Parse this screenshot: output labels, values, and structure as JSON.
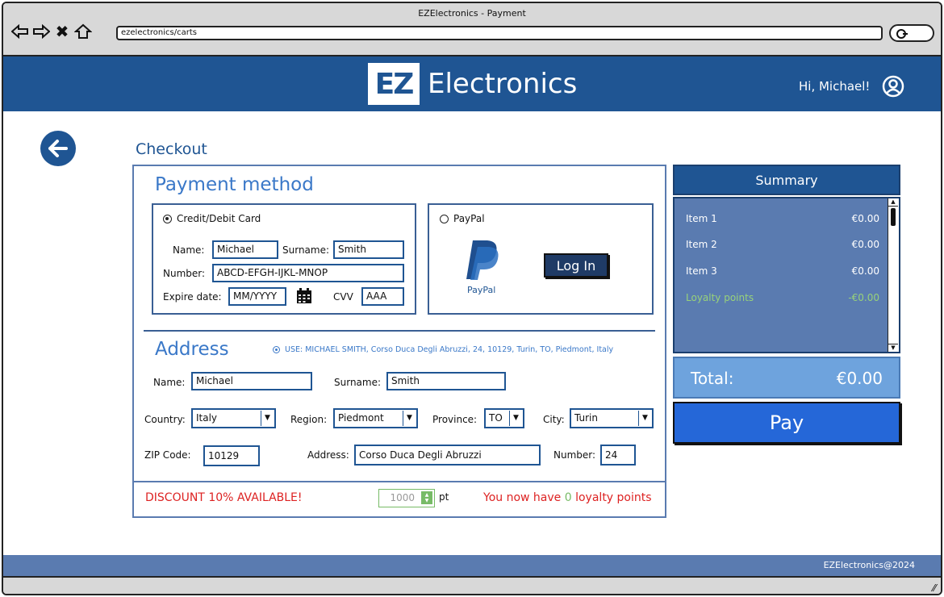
{
  "window": {
    "title": "EZElectronics - Payment",
    "url": "ezelectronics/carts"
  },
  "header": {
    "logo_mark": "EZ",
    "logo_text": "Electronics",
    "greeting": "Hi, Michael!"
  },
  "page": {
    "title": "Checkout"
  },
  "payment": {
    "section_title": "Payment method",
    "card_option": "Credit/Debit Card",
    "name_label": "Name:",
    "name_value": "Michael",
    "surname_label": "Surname:",
    "surname_value": "Smith",
    "number_label": "Number:",
    "number_value": "ABCD-EFGH-IJKL-MNOP",
    "expire_label": "Expire date:",
    "expire_value": "MM/YYYY",
    "cvv_label": "CVV",
    "cvv_value": "AAA",
    "paypal_option": "PayPal",
    "paypal_caption": "PayPal",
    "login_label": "Log In"
  },
  "address": {
    "section_title": "Address",
    "use_text": "USE:  MICHAEL SMITH, Corso Duca Degli Abruzzi, 24, 10129, Turin, TO, Piedmont, Italy",
    "name_label": "Name:",
    "name_value": "Michael",
    "surname_label": "Surname:",
    "surname_value": "Smith",
    "country_label": "Country:",
    "country_value": "Italy",
    "region_label": "Region:",
    "region_value": "Piedmont",
    "province_label": "Province:",
    "province_value": "TO",
    "city_label": "City:",
    "city_value": "Turin",
    "zip_label": "ZIP Code:",
    "zip_value": "10129",
    "address_label": "Address:",
    "address_value": "Corso Duca Degli Abruzzi",
    "number_label": "Number:",
    "number_value": "24"
  },
  "discount": {
    "message": "DISCOUNT 10% AVAILABLE!",
    "points_value": "1000",
    "points_unit": "pt",
    "loyalty_prefix": "You now have ",
    "loyalty_count": "0",
    "loyalty_suffix": " loyalty points"
  },
  "summary": {
    "title": "Summary",
    "items": [
      {
        "name": "Item 1",
        "price": "€0.00"
      },
      {
        "name": "Item 2",
        "price": "€0.00"
      },
      {
        "name": "Item 3",
        "price": "€0.00"
      }
    ],
    "loyalty_label": "Loyalty points",
    "loyalty_value": "-€0.00",
    "total_label": "Total:",
    "total_value": "€0.00",
    "pay_label": "Pay"
  },
  "footer": {
    "text": "EZElectronics@2024"
  },
  "colors": {
    "brand": "#1f5593",
    "accent": "#3a78c8",
    "pay": "#2567d8",
    "alert": "#dd2222",
    "positive": "#77bb66"
  }
}
